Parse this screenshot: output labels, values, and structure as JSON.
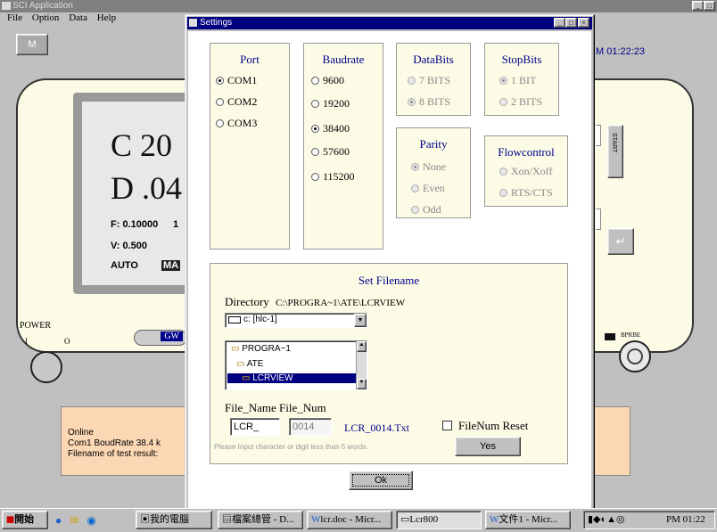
{
  "main": {
    "title": "SCI Application",
    "menu": [
      "File",
      "Option",
      "Data",
      "Help"
    ],
    "m_button": "M",
    "time": "M 01:22:23",
    "lcd": {
      "line1": "C  20",
      "line2": "D  .04",
      "f": "F: 0.10000",
      "f2": "1",
      "v": "V: 0.500",
      "auto": "AUTO",
      "ma": "MA"
    },
    "power_label": "POWER",
    "power_on": "I",
    "power_off": "O",
    "gw_label": "GW",
    "start_label": "START",
    "enter_icon": "enter-arrow-icon",
    "hipot_label": "BPRBE",
    "status": [
      "Online",
      "Com1 BoudRate 38.4 k",
      "Filename of test result:"
    ]
  },
  "dialog": {
    "title": "Settings",
    "port": {
      "title": "Port",
      "options": [
        "COM1",
        "COM2",
        "COM3"
      ],
      "selected": 0
    },
    "baudrate": {
      "title": "Baudrate",
      "options": [
        "9600",
        "19200",
        "38400",
        "57600",
        "115200"
      ],
      "selected": 2
    },
    "databits": {
      "title": "DataBits",
      "options": [
        "7 BITS",
        "8 BITS"
      ],
      "selected": 1
    },
    "stopbits": {
      "title": "StopBits",
      "options": [
        "1 BIT",
        "2 BITS"
      ],
      "selected": 0
    },
    "parity": {
      "title": "Parity",
      "options": [
        "None",
        "Even",
        "Odd"
      ],
      "selected": 0
    },
    "flowcontrol": {
      "title": "Flowcontrol",
      "options": [
        "Xon/Xoff",
        "RTS/CTS"
      ],
      "selected": -1
    },
    "filename": {
      "title": "Set Filename",
      "directory_label": "Directory",
      "directory_value": "C:\\PROGRA~1\\ATE\\LCRVIEW",
      "drive": "c: [hlc-1]",
      "folders": [
        "PROGRA~1",
        "ATE",
        "LCRVIEW"
      ],
      "field_labels": "File_Name File_Num",
      "file_name": "LCR_",
      "file_num": "0014",
      "result": "LCR_0014.Txt",
      "reset_label": "FileNum Reset",
      "hint": "Please Input character or digit less than 5 words.",
      "yes": "Yes"
    },
    "ok": "Ok"
  },
  "taskbar": {
    "start": "開始",
    "tasks": [
      "我的電腦",
      "檔案總管 - D...",
      "lcr.doc - Micr...",
      "Lcr800",
      "文件1 - Micr..."
    ],
    "clock": "PM 01:22"
  },
  "colors": {
    "dialog_title": "#000080",
    "group_title": "#00008b",
    "panel_bg": "#fbfbe6"
  }
}
